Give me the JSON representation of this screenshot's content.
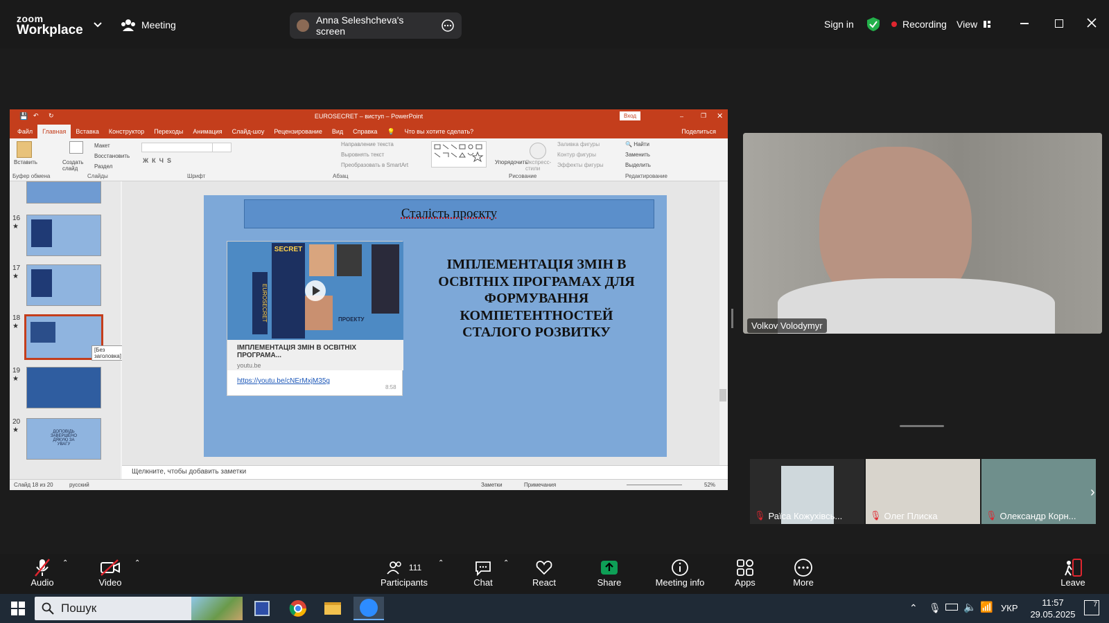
{
  "zoom": {
    "logo_line1": "zoom",
    "logo_line2": "Workplace",
    "meeting_label": "Meeting",
    "share_label": "Anna Seleshcheva's screen",
    "sign_in": "Sign in",
    "recording": "Recording",
    "view": "View"
  },
  "ppt": {
    "window_title": "EUROSECRET  –  виступ  –  PowerPoint",
    "login_button": "Вход",
    "tabs": [
      "Файл",
      "Главная",
      "Вставка",
      "Конструктор",
      "Переходы",
      "Анимация",
      "Слайд-шоу",
      "Рецензирование",
      "Вид",
      "Справка"
    ],
    "active_tab": "Главная",
    "tell_me": "Что вы хотите сделать?",
    "share": "Поделиться",
    "ribbon": {
      "paste": "Вставить",
      "clipboard": "Буфер обмена",
      "new_slide": "Создать слайд",
      "layout": "Макет",
      "reset": "Восстановить",
      "section": "Раздел",
      "slides": "Слайды",
      "font": "Шрифт",
      "paragraph": "Абзац",
      "text_direction": "Направление текста",
      "align_text": "Выровнять текст",
      "smartart": "Преобразовать в SmartArt",
      "drawing": "Рисование",
      "arrange": "Упорядочить",
      "quick_styles": "Экспресс-стили",
      "shape_fill": "Заливка фигуры",
      "shape_outline": "Контур фигуры",
      "shape_effects": "Эффекты фигуры",
      "find": "Найти",
      "replace": "Заменить",
      "select": "Выделить",
      "editing": "Редактирование"
    },
    "thumbnails": [
      {
        "num": "16",
        "star": "★"
      },
      {
        "num": "17",
        "star": "★"
      },
      {
        "num": "18",
        "star": "★"
      },
      {
        "num": "19",
        "star": "★"
      },
      {
        "num": "20",
        "star": "★"
      }
    ],
    "thumb20_text": "ДОПОВІДЬ ЗАВЕРШЕНО ДЯКУЮ ЗА УВАГУ",
    "tooltip": "[Без заголовка]",
    "slide": {
      "title": "Сталість проєкту",
      "body": "ІМПЛЕМЕНТАЦІЯ ЗМІН В ОСВІТНІХ ПРОГРАМАХ ДЛЯ ФОРМУВАННЯ КОМПЕТЕНТНОСТЕЙ СТАЛОГО РОЗВИТКУ",
      "card_title": "ІМПЛЕМЕНТАЦІЯ ЗМІН В ОСВІТНІХ ПРОГРАМА...",
      "card_domain": "youtu.be",
      "card_link": "https://youtu.be/cNErMxjM35g",
      "card_duration": "8:58",
      "card_img_text_1": "SECRET",
      "card_img_text_2": "EUROSECRET",
      "card_img_text_3": "ПРОЕКТУ"
    },
    "notes_placeholder": "Щелкните, чтобы добавить заметки",
    "status": {
      "slide": "Слайд 18 из 20",
      "language": "русский",
      "notes": "Заметки",
      "comments": "Примечания",
      "zoom": "52%"
    }
  },
  "participants": {
    "speaker": "Volkov Volodymyr",
    "tiles": [
      "Раїса Кожухівсь...",
      "Олег Плиска",
      "Олександр Корн..."
    ]
  },
  "toolbar": {
    "audio": "Audio",
    "video": "Video",
    "participants": "Participants",
    "participants_count": "111",
    "chat": "Chat",
    "react": "React",
    "share": "Share",
    "meeting_info": "Meeting info",
    "apps": "Apps",
    "more": "More",
    "leave": "Leave"
  },
  "taskbar": {
    "search": "Пошук",
    "language": "УКР",
    "time": "11:57",
    "date": "29.05.2025",
    "notifications": "7"
  },
  "colors": {
    "ppt_accent": "#c43e1c",
    "slide_bg": "#7da8d8",
    "zoom_bg": "#1a1a1a",
    "share_green": "#0e9f56",
    "recording_red": "#e0262f"
  }
}
